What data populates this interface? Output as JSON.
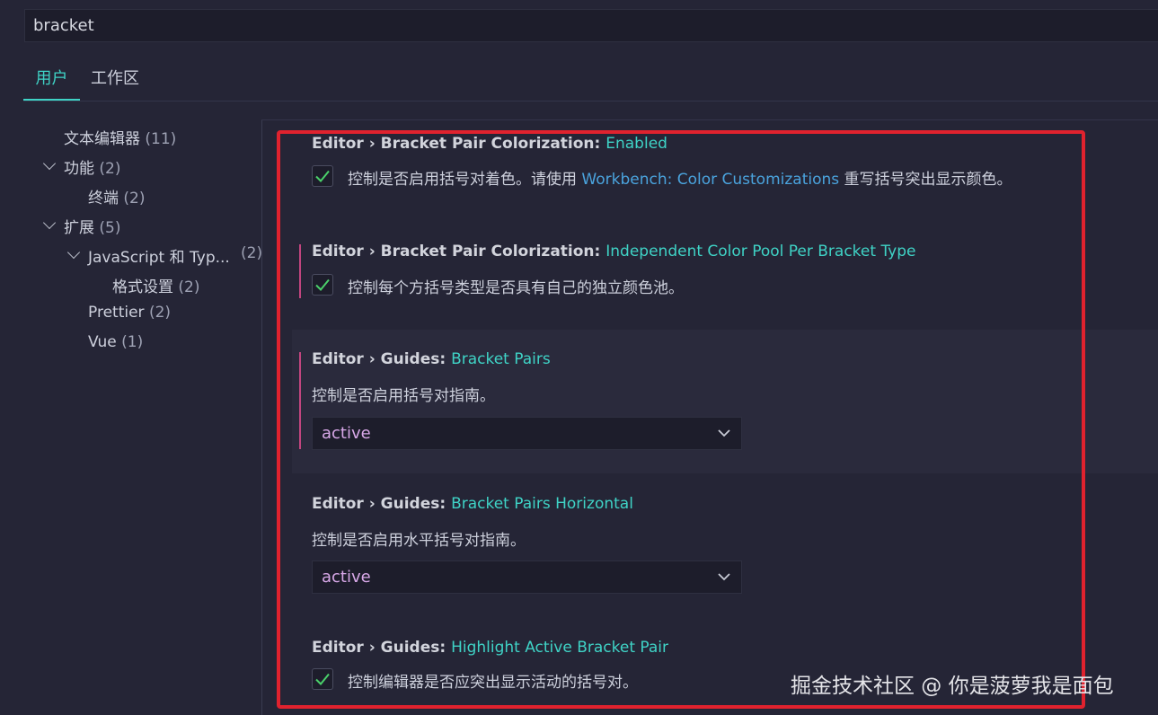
{
  "search": {
    "value": "bracket"
  },
  "tabs": [
    {
      "label": "用户",
      "active": true
    },
    {
      "label": "工作区",
      "active": false
    }
  ],
  "toc": [
    {
      "label": "文本编辑器",
      "count": "(11)"
    },
    {
      "label": "功能",
      "count": "(2)",
      "expanded": true
    },
    {
      "label": "终端",
      "count": "(2)"
    },
    {
      "label": "扩展",
      "count": "(5)",
      "expanded": true
    },
    {
      "label": "JavaScript 和 Typ...",
      "count": "(2)",
      "expanded": true
    },
    {
      "label": "格式设置",
      "count": "(2)"
    },
    {
      "label": "Prettier",
      "count": "(2)"
    },
    {
      "label": "Vue",
      "count": "(1)"
    }
  ],
  "settings": [
    {
      "category": "Editor › Bracket Pair Colorization: ",
      "name": "Enabled",
      "desc_before": "控制是否启用括号对着色。请使用 ",
      "desc_link": "Workbench: Color Customizations",
      "desc_after": " 重写括号突出显示颜色。",
      "checked": true
    },
    {
      "category": "Editor › Bracket Pair Colorization: ",
      "name": "Independent Color Pool Per Bracket Type",
      "desc": "控制每个方括号类型是否具有自己的独立颜色池。",
      "checked": true,
      "modified": true
    },
    {
      "category": "Editor › Guides: ",
      "name": "Bracket Pairs",
      "desc": "控制是否启用括号对指南。",
      "value": "active",
      "modified": true
    },
    {
      "category": "Editor › Guides: ",
      "name": "Bracket Pairs Horizontal",
      "desc": "控制是否启用水平括号对指南。",
      "value": "active"
    },
    {
      "category": "Editor › Guides: ",
      "name": "Highlight Active Bracket Pair",
      "desc": "控制编辑器是否应突出显示活动的括号对。",
      "checked": true
    }
  ],
  "watermark": "掘金技术社区 @ 你是菠萝我是面包",
  "colors": {
    "accent": "#3fd3c6",
    "link": "#4aa3dd",
    "modified": "#c2457f",
    "highlight_box": "#e0222e",
    "check": "#4ad06a"
  }
}
